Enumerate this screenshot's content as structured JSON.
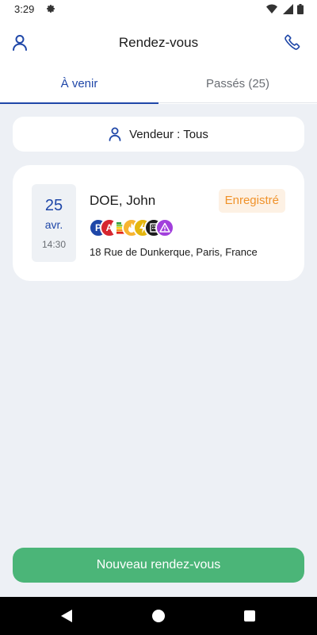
{
  "status_bar": {
    "time": "3:29",
    "icons": [
      "settings-gear-icon",
      "wifi-icon",
      "cell-signal-icon",
      "battery-icon"
    ]
  },
  "app_bar": {
    "title": "Rendez-vous",
    "left_icon": "person-icon",
    "right_icon": "phone-icon"
  },
  "tabs": [
    {
      "label": "À venir",
      "active": true
    },
    {
      "label": "Passés (25)",
      "active": false
    }
  ],
  "filter": {
    "label": "Vendeur : Tous",
    "icon": "person-icon"
  },
  "appointments": [
    {
      "day": "25",
      "month": "avr.",
      "time": "14:30",
      "name": "DOE, John",
      "status": "Enregistré",
      "address": "18 Rue de Dunkerque, Paris, France",
      "badges": [
        {
          "icon": "p-badge-icon",
          "label": "P",
          "color": "#1f47a8"
        },
        {
          "icon": "a-badge-icon",
          "label": "A",
          "color": "#d6262f"
        },
        {
          "icon": "energy-rating-icon",
          "label": "",
          "color": "#f3a322"
        },
        {
          "icon": "gas-badge-icon",
          "label": "",
          "color": "#f7b431"
        },
        {
          "icon": "electricity-badge-icon",
          "label": "",
          "color": "#e4b60e"
        },
        {
          "icon": "building-badge-icon",
          "label": "",
          "color": "#1c1c1c"
        },
        {
          "icon": "warning-badge-icon",
          "label": "",
          "color": "#a13fdc"
        }
      ]
    }
  ],
  "primary_action": {
    "label": "Nouveau rendez-vous"
  },
  "colors": {
    "primary_blue": "#1f47a8",
    "background": "#edf0f5",
    "success_green": "#4bb578",
    "status_orange": "#f0922a",
    "status_orange_bg": "#fdf1e4"
  }
}
